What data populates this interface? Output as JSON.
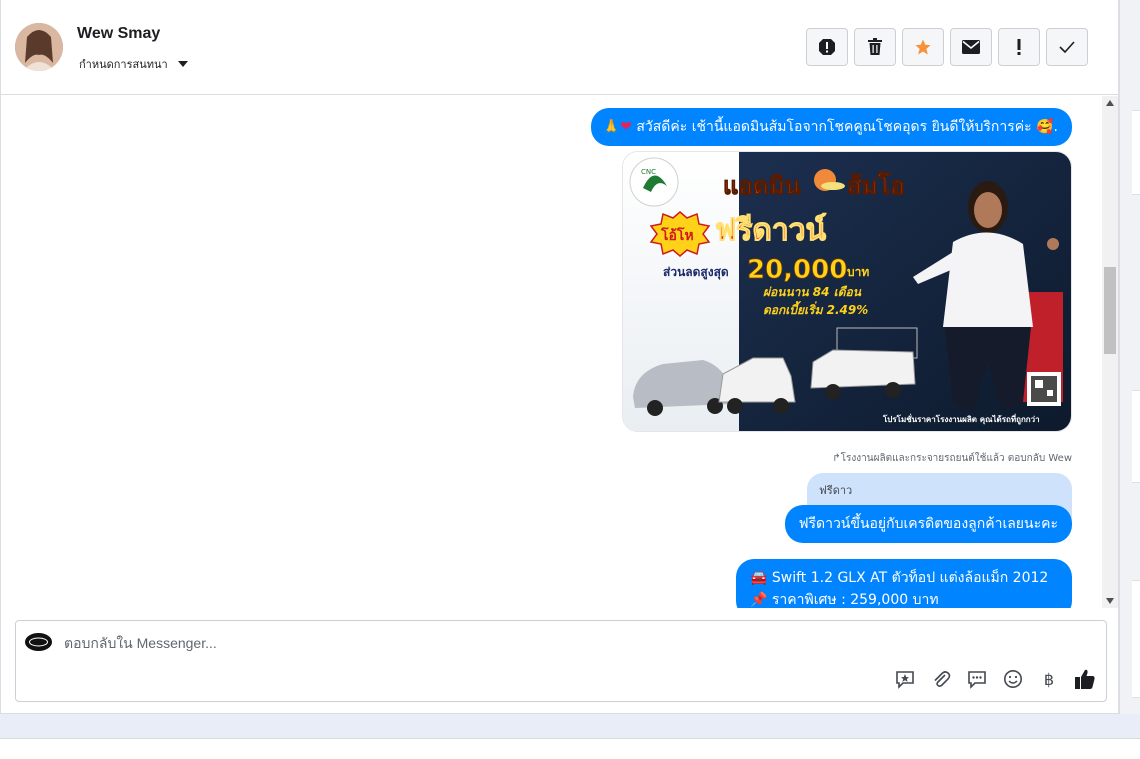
{
  "header": {
    "name": "Wew Smay",
    "subtitle": "กำหนดการสนทนา",
    "actions": [
      "report-icon",
      "trash-icon",
      "star-icon",
      "mail-icon",
      "exclamation-icon",
      "check-icon"
    ]
  },
  "messages": {
    "greeting_prefix": "🙏",
    "greeting_heart": "❤",
    "greeting_text": " สวัสดีค่ะ เช้านี้แอดมินส้มโอจากโชคคูณโชคอุดร ยินดีให้บริการค่ะ 🥰.",
    "promo": {
      "title_left": "แอดมิน",
      "title_right": "ส้มโอ",
      "badge": "โอ้โห",
      "headline": "ฟรีดาวน์",
      "discount_label": "ส่วนลดสูงสุด",
      "discount_value": "20,000",
      "discount_unit": "บาท",
      "installment": "ผ่อนนาน 84 เดือน",
      "interest": "ดอกเบี้ยเริ่ม 2.49%",
      "footer": "โปรโมชั่นราคาโรงงานผลิต คุณได้รถที่ถูกกว่า",
      "logo_text": "CNC"
    },
    "reply_meta": "โรงงานผลิตและกระจายรถยนต์ใช้แล้ว ตอบกลับ Wew",
    "quoted_text": "ฟรีดาว",
    "reply_text": "ฟรีดาวน์ขึ้นอยู่กับเครดิตของลูกค้าเลยนะคะ",
    "car_line1": "🚘 Swift 1.2 GLX AT ตัวท็อป แต่งล้อแม็ก 2012",
    "car_line2": "📌 ราคาพิเศษ : 259,000 บาท"
  },
  "composer": {
    "placeholder": "ตอบกลับใน Messenger...",
    "tools": [
      "saved-reply-icon",
      "attachment-icon",
      "chat-icon",
      "emoji-icon",
      "baht-icon",
      "like-icon"
    ],
    "baht_symbol": "฿"
  },
  "colors": {
    "bubble": "#0084ff",
    "quote": "#cfe2fb",
    "star": "#f7923a"
  }
}
